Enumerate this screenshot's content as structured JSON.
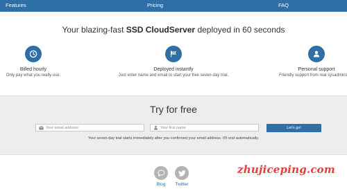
{
  "nav": {
    "features": "Features",
    "pricing": "Pricing",
    "faq": "FAQ"
  },
  "hero": {
    "prefix": "Your blazing-fast ",
    "bold": "SSD CloudServer",
    "suffix": " deployed in 60 seconds"
  },
  "features": {
    "billed": {
      "icon": "clock-icon",
      "title": "Billed hourly",
      "desc": "Only pay what you really use."
    },
    "deployed": {
      "icon": "flag-icon",
      "title": "Deployed instantly",
      "desc": "Just enter name and email to start your free seven-day trial."
    },
    "support": {
      "icon": "user-icon",
      "title": "Personal support",
      "desc": "Friendly support from real sysadmins wh"
    }
  },
  "trial": {
    "title": "Try for free",
    "email_placeholder": "Your email address",
    "name_placeholder": "Your first name",
    "button": "Let's go!",
    "note": "Your seven-day trial starts immediately after you confirmed your email address. It'll end automatically."
  },
  "social": {
    "blog": "Blog",
    "twitter": "Twitter"
  },
  "watermark": "zhujiceping.com",
  "colors": {
    "brand_blue": "#2f6fa7",
    "band_gray": "#ededed",
    "icon_gray": "#b3b3b3",
    "watermark_red": "#e0413a"
  }
}
